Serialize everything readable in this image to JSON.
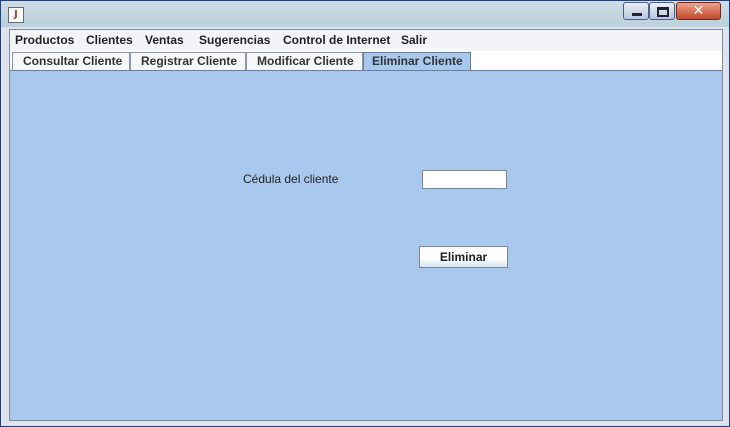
{
  "menubar": {
    "items": [
      "Productos",
      "Clientes",
      "Ventas",
      "Sugerencias",
      "Control de Internet",
      "Salir"
    ]
  },
  "tabs": [
    {
      "label": "Consultar Cliente",
      "active": false
    },
    {
      "label": "Registrar Cliente",
      "active": false
    },
    {
      "label": "Modificar Cliente",
      "active": false
    },
    {
      "label": "Eliminar Cliente",
      "active": true
    }
  ],
  "form": {
    "cedula_label": "Cédula del cliente",
    "cedula_value": "",
    "delete_button": "Eliminar"
  },
  "titlebar": {
    "close_glyph": "✕"
  },
  "colors": {
    "panel_bg": "#a8c8ee",
    "close_button": "#c4472a"
  }
}
